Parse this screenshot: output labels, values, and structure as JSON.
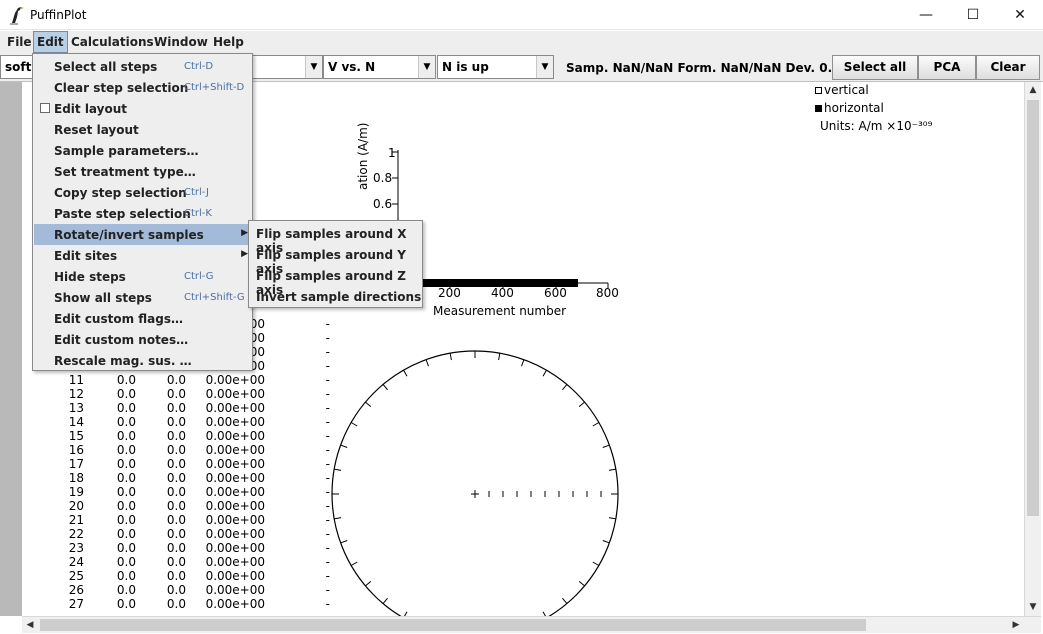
{
  "window": {
    "title": "PuffinPlot",
    "minimize": "—",
    "maximize": "☐",
    "close": "✕"
  },
  "menubar": {
    "items": [
      "File",
      "Edit",
      "Calculations",
      "Window",
      "Help"
    ]
  },
  "toolbar": {
    "sample_combo": "softp",
    "projection_combo": "V vs. N",
    "orientation_combo": "N is up",
    "info": "Samp. NaN/NaN Form. NaN/NaN Dev. 0.0 Anc:Y",
    "select_all": "Select all",
    "pca": "PCA",
    "clear": "Clear"
  },
  "edit_menu": {
    "items": [
      {
        "label": "Select all steps",
        "shortcut": "Ctrl-D"
      },
      {
        "label": "Clear step selection",
        "shortcut": "Ctrl+Shift-D"
      },
      {
        "label": "Edit layout",
        "shortcut": "",
        "checkbox": true
      },
      {
        "label": "Reset layout",
        "shortcut": ""
      },
      {
        "label": "Sample parameters…",
        "shortcut": ""
      },
      {
        "label": "Set treatment type…",
        "shortcut": ""
      },
      {
        "label": "Copy step selection",
        "shortcut": "Ctrl-J"
      },
      {
        "label": "Paste step selection",
        "shortcut": "Ctrl-K"
      },
      {
        "label": "Rotate/invert samples",
        "shortcut": "",
        "submenu": true
      },
      {
        "label": "Edit sites",
        "shortcut": "",
        "submenu": true
      },
      {
        "label": "Hide steps",
        "shortcut": "Ctrl-G"
      },
      {
        "label": "Show all steps",
        "shortcut": "Ctrl+Shift-G"
      },
      {
        "label": "Edit custom flags…",
        "shortcut": ""
      },
      {
        "label": "Edit custom notes…",
        "shortcut": ""
      },
      {
        "label": "Rescale mag. sus. …",
        "shortcut": ""
      }
    ]
  },
  "rotate_submenu": {
    "items": [
      "Flip samples around X axis",
      "Flip samples around Y axis",
      "Flip samples around Z axis",
      "Invert sample directions"
    ]
  },
  "legend": {
    "vertical": "vertical",
    "horizontal": "horizontal",
    "units": "Units: A/m ×10⁻³⁰⁹"
  },
  "demag_plot": {
    "ylabel_fragment": "ation (A/m)",
    "y_ticks": [
      "1",
      "0.8",
      "0.6"
    ],
    "x_ticks": [
      "200",
      "400",
      "600",
      "800"
    ],
    "xlabel": "Measurement number"
  },
  "table": {
    "rows": [
      {
        "n": "",
        "a": "",
        "b": "",
        "c": "0.00e+00",
        "d": "-"
      },
      {
        "n": "",
        "a": "",
        "b": "",
        "c": "0.00e+00",
        "d": "-"
      },
      {
        "n": "",
        "a": "",
        "b": "",
        "c": "0.00e+00",
        "d": "-"
      },
      {
        "n": "",
        "a": "",
        "b": "",
        "c": "0.00e+00",
        "d": "-"
      },
      {
        "n": "11",
        "a": "0.0",
        "b": "0.0",
        "c": "0.00e+00",
        "d": "-"
      },
      {
        "n": "12",
        "a": "0.0",
        "b": "0.0",
        "c": "0.00e+00",
        "d": "-"
      },
      {
        "n": "13",
        "a": "0.0",
        "b": "0.0",
        "c": "0.00e+00",
        "d": "-"
      },
      {
        "n": "14",
        "a": "0.0",
        "b": "0.0",
        "c": "0.00e+00",
        "d": "-"
      },
      {
        "n": "15",
        "a": "0.0",
        "b": "0.0",
        "c": "0.00e+00",
        "d": "-"
      },
      {
        "n": "16",
        "a": "0.0",
        "b": "0.0",
        "c": "0.00e+00",
        "d": "-"
      },
      {
        "n": "17",
        "a": "0.0",
        "b": "0.0",
        "c": "0.00e+00",
        "d": "-"
      },
      {
        "n": "18",
        "a": "0.0",
        "b": "0.0",
        "c": "0.00e+00",
        "d": "-"
      },
      {
        "n": "19",
        "a": "0.0",
        "b": "0.0",
        "c": "0.00e+00",
        "d": "-"
      },
      {
        "n": "20",
        "a": "0.0",
        "b": "0.0",
        "c": "0.00e+00",
        "d": "-"
      },
      {
        "n": "21",
        "a": "0.0",
        "b": "0.0",
        "c": "0.00e+00",
        "d": "-"
      },
      {
        "n": "22",
        "a": "0.0",
        "b": "0.0",
        "c": "0.00e+00",
        "d": "-"
      },
      {
        "n": "23",
        "a": "0.0",
        "b": "0.0",
        "c": "0.00e+00",
        "d": "-"
      },
      {
        "n": "24",
        "a": "0.0",
        "b": "0.0",
        "c": "0.00e+00",
        "d": "-"
      },
      {
        "n": "25",
        "a": "0.0",
        "b": "0.0",
        "c": "0.00e+00",
        "d": "-"
      },
      {
        "n": "26",
        "a": "0.0",
        "b": "0.0",
        "c": "0.00e+00",
        "d": "-"
      },
      {
        "n": "27",
        "a": "0.0",
        "b": "0.0",
        "c": "0.00e+00",
        "d": "-"
      }
    ]
  }
}
